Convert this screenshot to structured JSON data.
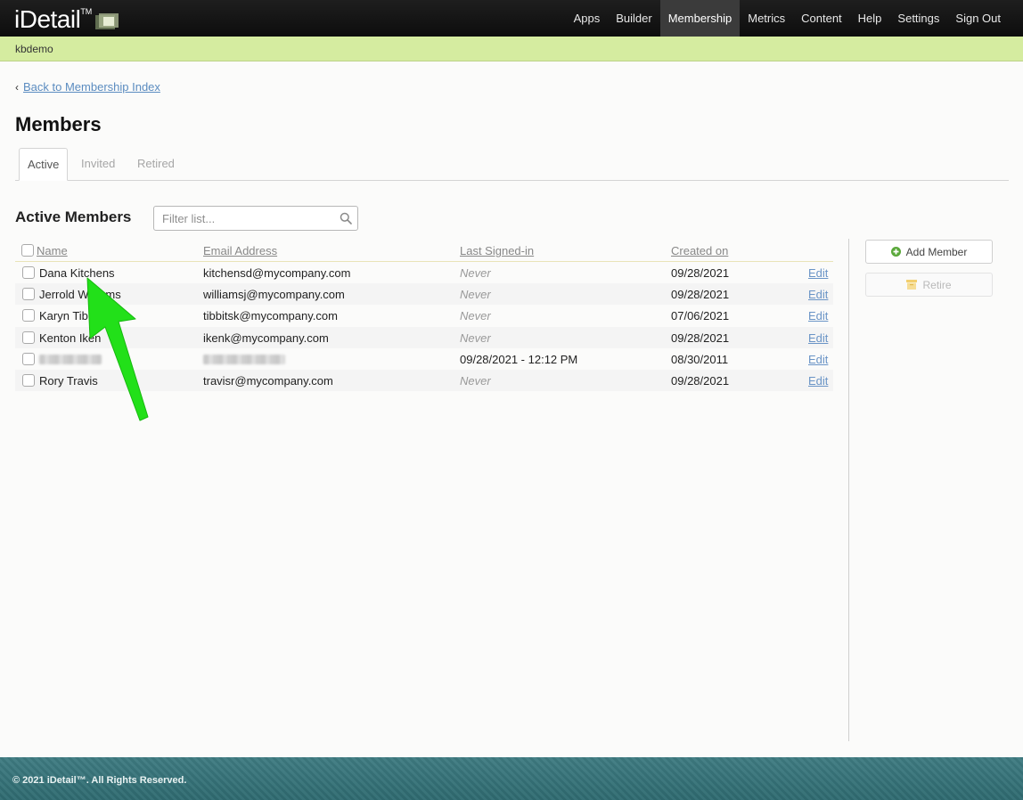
{
  "app": {
    "logo_text": "iDetail",
    "logo_tm": "TM"
  },
  "nav": {
    "items": [
      {
        "label": "Apps"
      },
      {
        "label": "Builder"
      },
      {
        "label": "Membership",
        "active": true
      },
      {
        "label": "Metrics"
      },
      {
        "label": "Content"
      },
      {
        "label": "Help"
      },
      {
        "label": "Settings"
      },
      {
        "label": "Sign Out"
      }
    ]
  },
  "org": {
    "name": "kbdemo"
  },
  "back_link": {
    "label": "Back to Membership Index",
    "icon": "chevron-left-icon"
  },
  "page_title": "Members",
  "tabs": [
    {
      "label": "Active",
      "active": true
    },
    {
      "label": "Invited"
    },
    {
      "label": "Retired"
    }
  ],
  "section_title": "Active Members",
  "filter": {
    "placeholder": "Filter list...",
    "value": "",
    "icon": "search-icon"
  },
  "table": {
    "columns": [
      "Name",
      "Email Address",
      "Last Signed-in",
      "Created on"
    ],
    "rows": [
      {
        "name": "Dana Kitchens",
        "email": "kitchensd@mycompany.com",
        "last_signed_in": "Never",
        "created_on": "09/28/2021",
        "action": "Edit"
      },
      {
        "name": "Jerrold Williams",
        "email": "williamsj@mycompany.com",
        "last_signed_in": "Never",
        "created_on": "09/28/2021",
        "action": "Edit"
      },
      {
        "name": "Karyn Tibbits",
        "email": "tibbitsk@mycompany.com",
        "last_signed_in": "Never",
        "created_on": "07/06/2021",
        "action": "Edit"
      },
      {
        "name": "Kenton Iken",
        "email": "ikenk@mycompany.com",
        "last_signed_in": "Never",
        "created_on": "09/28/2021",
        "action": "Edit"
      },
      {
        "name": "",
        "email": "",
        "last_signed_in": "09/28/2021 - 12:12 PM",
        "created_on": "08/30/2011",
        "action": "Edit",
        "redacted": true
      },
      {
        "name": "Rory Travis",
        "email": "travisr@mycompany.com",
        "last_signed_in": "Never",
        "created_on": "09/28/2021",
        "action": "Edit"
      }
    ]
  },
  "actions": {
    "add_member": {
      "label": "Add Member",
      "icon": "plus-circle-icon",
      "color": "#5aa83a"
    },
    "retire": {
      "label": "Retire",
      "icon": "archive-icon",
      "color": "#f2cf6e"
    }
  },
  "footer": {
    "copyright": "© 2021 iDetail™. All Rights Reserved."
  },
  "annotation": {
    "icon": "green-arrow-icon",
    "color": "#22e019"
  }
}
